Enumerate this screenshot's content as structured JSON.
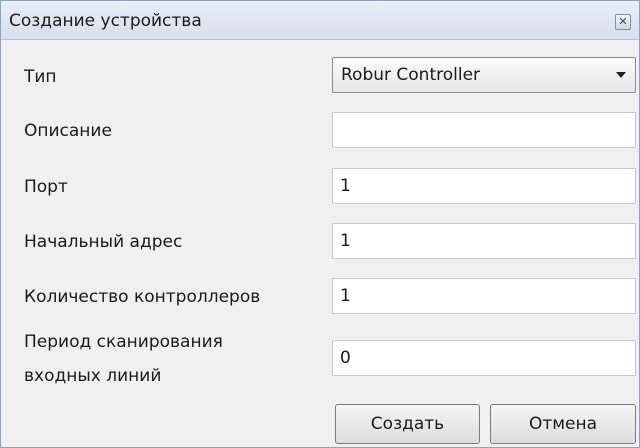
{
  "dialog": {
    "title": "Создание устройства",
    "close_icon": "close-icon"
  },
  "form": {
    "type_label": "Тип",
    "type_value": "Robur Controller",
    "description_label": "Описание",
    "description_value": "",
    "port_label": "Порт",
    "port_value": "1",
    "start_address_label": "Начальный адрес",
    "start_address_value": "1",
    "controllers_count_label": "Количество контроллеров",
    "controllers_count_value": "1",
    "scan_period_label_line1": "Период сканирования",
    "scan_period_label_line2": "входных линий",
    "scan_period_value": "0"
  },
  "buttons": {
    "create": "Создать",
    "cancel": "Отмена"
  }
}
